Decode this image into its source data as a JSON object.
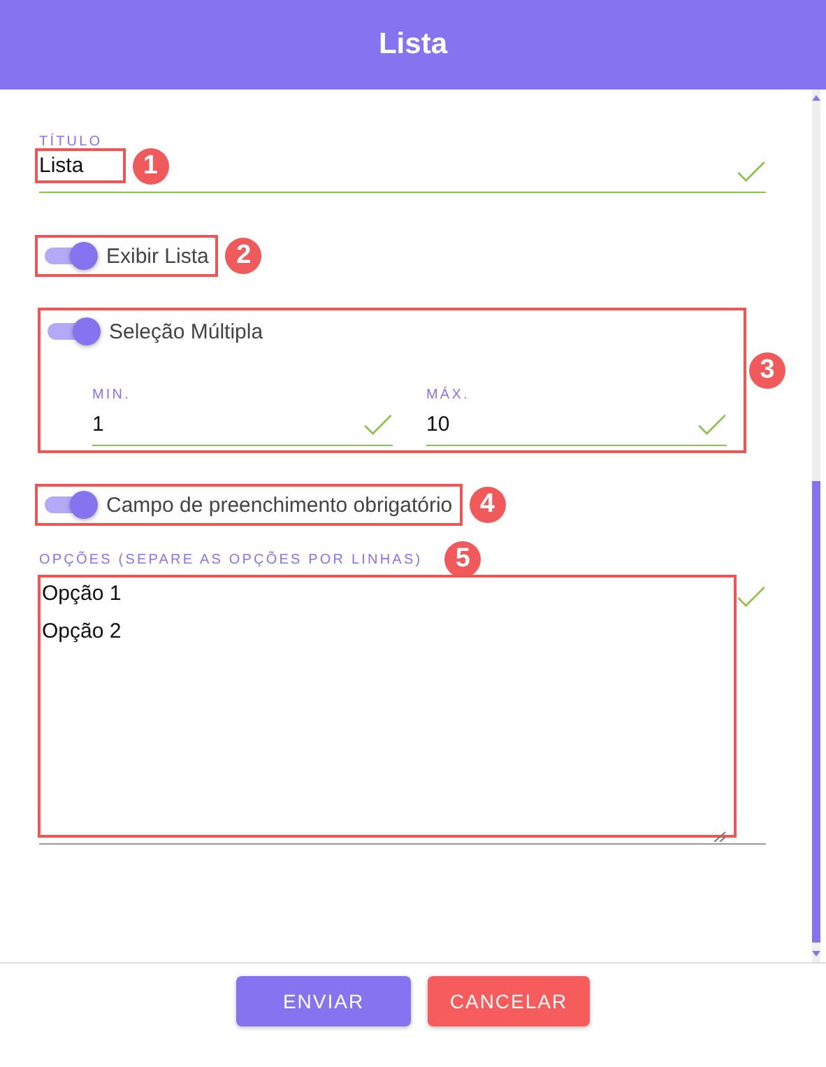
{
  "header": {
    "title": "Lista"
  },
  "form": [
    {
      "kind": "text",
      "label": "TÍTULO",
      "value": "Lista",
      "valid": true,
      "callout": "1"
    },
    {
      "kind": "toggle",
      "label": "Exibir Lista",
      "on": true,
      "callout": "2"
    },
    {
      "kind": "group",
      "callout": "3",
      "toggle": {
        "label": "Seleção Múltipla",
        "on": true
      },
      "fields": [
        {
          "label": "MIN.",
          "value": "1",
          "valid": true
        },
        {
          "label": "MÁX.",
          "value": "10",
          "valid": true
        }
      ]
    },
    {
      "kind": "toggle",
      "label": "Campo de preenchimento obrigatório",
      "on": true,
      "callout": "4"
    },
    {
      "kind": "textarea",
      "label": "OPÇÕES (SEPARE AS OPÇÕES POR LINHAS)",
      "lines": [
        "Opção 1",
        "Opção 2"
      ],
      "valid": true,
      "callout": "5"
    }
  ],
  "buttons": [
    {
      "kind": "primary",
      "label": "ENVIAR"
    },
    {
      "kind": "danger",
      "label": "CANCELAR"
    }
  ]
}
